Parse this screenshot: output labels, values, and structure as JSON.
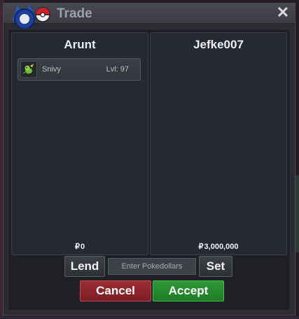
{
  "window": {
    "title": "Trade",
    "close_symbol": "✕"
  },
  "left_panel": {
    "player_name": "Arunt",
    "currency_symbol": "₽",
    "money": "0",
    "items": [
      {
        "name": "Snivy",
        "level": "Lvl: 97",
        "icon": "snivy-sprite-icon"
      }
    ]
  },
  "right_panel": {
    "player_name": "Jefke007",
    "currency_symbol": "₽",
    "money": "3,000,000"
  },
  "controls": {
    "lend_label": "Lend",
    "money_placeholder": "Enter Pokedollars",
    "set_label": "Set",
    "cancel_label": "Cancel",
    "accept_label": "Accept"
  },
  "colors": {
    "cancel": "#8b242c",
    "accept": "#268a2f",
    "panel_bg": "#262833"
  }
}
